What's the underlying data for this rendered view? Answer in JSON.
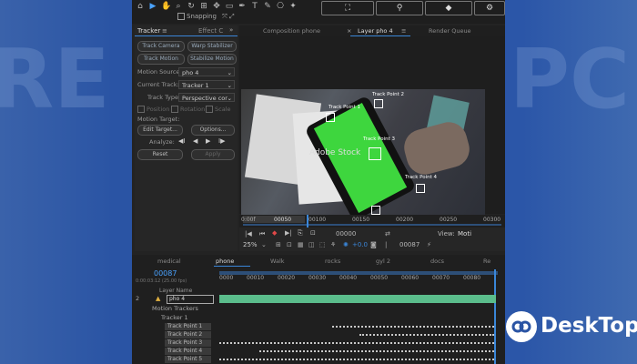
{
  "toolbar": {
    "snapping_label": "Snapping",
    "toggle_label": "Snapping"
  },
  "tracker_panel": {
    "title": "Tracker",
    "effects_tab": "Effect C",
    "buttons": [
      "Track Camera",
      "Warp Stabilizer",
      "Track Motion",
      "Stabilize Motion"
    ],
    "motion_source_label": "Motion Source:",
    "motion_source_value": "pho 4",
    "current_track_label": "Current Track:",
    "current_track_value": "Tracker 1",
    "track_type_label": "Track Type:",
    "track_type_value": "Perspective cor",
    "options": [
      "Position",
      "Rotation",
      "Scale"
    ],
    "motion_target_label": "Motion Target:",
    "edit_target_button": "Edit Target...",
    "options_button": "Options...",
    "analyze_label": "Analyze:",
    "reset_button": "Reset",
    "apply_button": "Apply"
  },
  "viewer": {
    "tabs": [
      "Composition phone",
      "Layer pho 4",
      "Render Queue"
    ],
    "track_points": [
      "Track Point 2",
      "Track Point 1",
      "Track Point 3",
      "Track Point 4"
    ],
    "watermark": "Adobe Stock",
    "ruler": [
      "0:00f",
      "00050",
      "00100",
      "00150",
      "00200",
      "00250",
      "00300"
    ],
    "timecode": "00000",
    "timecode2": "00087",
    "zoom": "25%",
    "offset": "+0.0",
    "view_label": "View:",
    "view_value": "Moti"
  },
  "timeline": {
    "tabs": [
      "medical",
      "phone",
      "Walk",
      "rocks",
      "gyl 2",
      "docs",
      "Re"
    ],
    "current_time": "00087",
    "subtime": "0:00:03:12 (25.00 fps)",
    "ruler": [
      "0000",
      "00010",
      "00020",
      "00030",
      "00040",
      "00050",
      "00060",
      "00070",
      "00080"
    ],
    "layer_name_header": "Layer Name",
    "layer_index": "2",
    "layer_name": "pho 4",
    "motion_trackers": "Motion Trackers",
    "tracker1": "Tracker 1",
    "track_points": [
      "Track Point 1",
      "Track Point 2",
      "Track Point 3",
      "Track Point 4",
      "Track Point 5"
    ]
  },
  "watermark": {
    "text": "DeskTop"
  },
  "colors": {
    "accent": "#3a86d8",
    "green_screen": "#3ed63e",
    "timeline_bar": "#5bbd8c"
  }
}
